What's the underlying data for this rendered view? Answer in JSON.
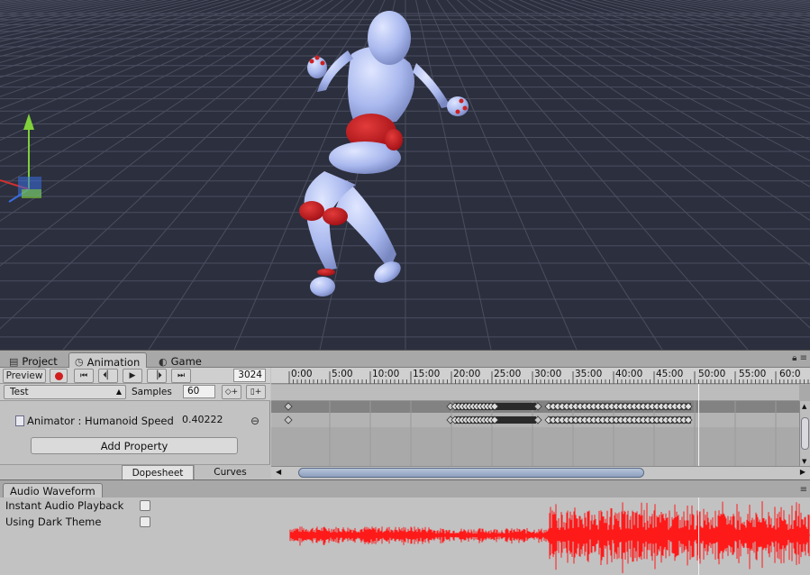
{
  "tabs": [
    {
      "label": "Project",
      "icon": "folder-icon"
    },
    {
      "label": "Animation",
      "icon": "clock-icon",
      "active": true
    },
    {
      "label": "Game",
      "icon": "game-icon"
    }
  ],
  "controls": {
    "preview_label": "Preview",
    "current_frame": "3024",
    "record_color": "#d01e1e"
  },
  "clip": {
    "selected": "Test",
    "samples_label": "Samples",
    "samples_value": "60"
  },
  "property": {
    "label": "Animator : Humanoid Speed",
    "value": "0.40222"
  },
  "add_property_label": "Add Property",
  "view_tabs": {
    "dopesheet": "Dopesheet",
    "curves": "Curves"
  },
  "timeline": {
    "ticks": [
      "0:00",
      "5:00",
      "10:00",
      "15:00",
      "20:00",
      "25:00",
      "30:00",
      "35:00",
      "40:00",
      "45:00",
      "50:00",
      "55:00",
      "60:0"
    ],
    "playhead_time": "49:30"
  },
  "audio": {
    "tab_label": "Audio Waveform",
    "instant_playback_label": "Instant Audio Playback",
    "instant_playback_checked": false,
    "dark_theme_label": "Using Dark Theme",
    "dark_theme_checked": false,
    "wave_color": "#ff1a1a"
  }
}
